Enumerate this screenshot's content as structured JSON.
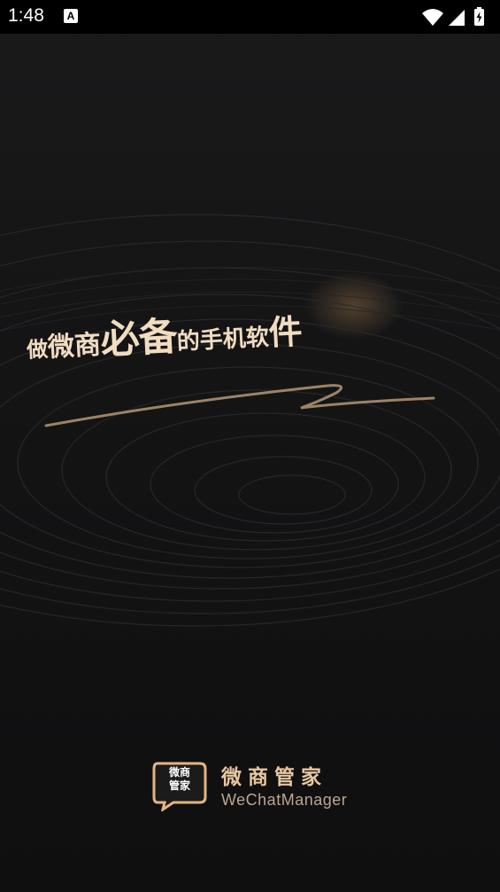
{
  "status_bar": {
    "time": "1:48",
    "notification_icon": "A",
    "icons": [
      "wifi-icon",
      "signal-icon",
      "battery-charging-icon"
    ]
  },
  "splash": {
    "tagline": {
      "part1": "做",
      "part2": "微商",
      "part3": "必备",
      "part4": "的手机软",
      "part5": "件"
    },
    "logo": {
      "badge_line1": "微商",
      "badge_line2": "管家",
      "name": "微商管家",
      "name_en": "WeChatManager"
    }
  },
  "colors": {
    "background": "#141415",
    "accent_gold": "#e9c7a0",
    "badge_fill": "#1b1b1c",
    "badge_stroke": "#e3b485"
  }
}
